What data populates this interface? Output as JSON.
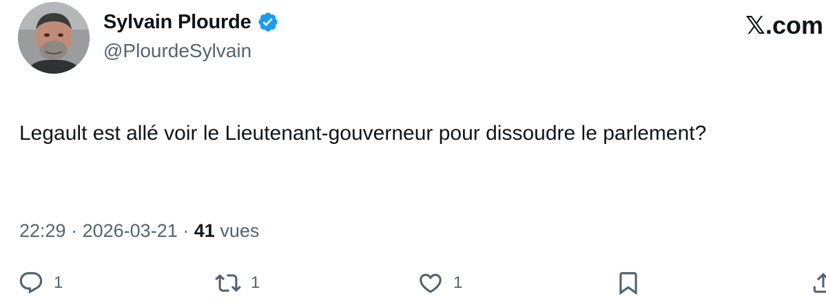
{
  "author": {
    "display_name": "Sylvain Plourde",
    "handle": "@PlourdeSylvain",
    "verified": true,
    "avatar_icon": "profile-photo"
  },
  "source": "𝕏.com",
  "tweet": {
    "text": "Legault est allé voir le Lieutenant-gouverneur pour dissoudre le parlement?",
    "time": "22:29",
    "date": "2026-03-21",
    "separator": "·",
    "views_count": "41",
    "views_label": "vues"
  },
  "actions": {
    "reply": {
      "icon": "reply-icon",
      "count": "1"
    },
    "retweet": {
      "icon": "retweet-icon",
      "count": "1"
    },
    "like": {
      "icon": "heart-icon",
      "count": "1"
    },
    "bookmark": {
      "icon": "bookmark-icon"
    },
    "share": {
      "icon": "share-icon"
    }
  },
  "colors": {
    "text": "#0f1419",
    "secondary": "#536471",
    "verified": "#1d9bf0"
  }
}
